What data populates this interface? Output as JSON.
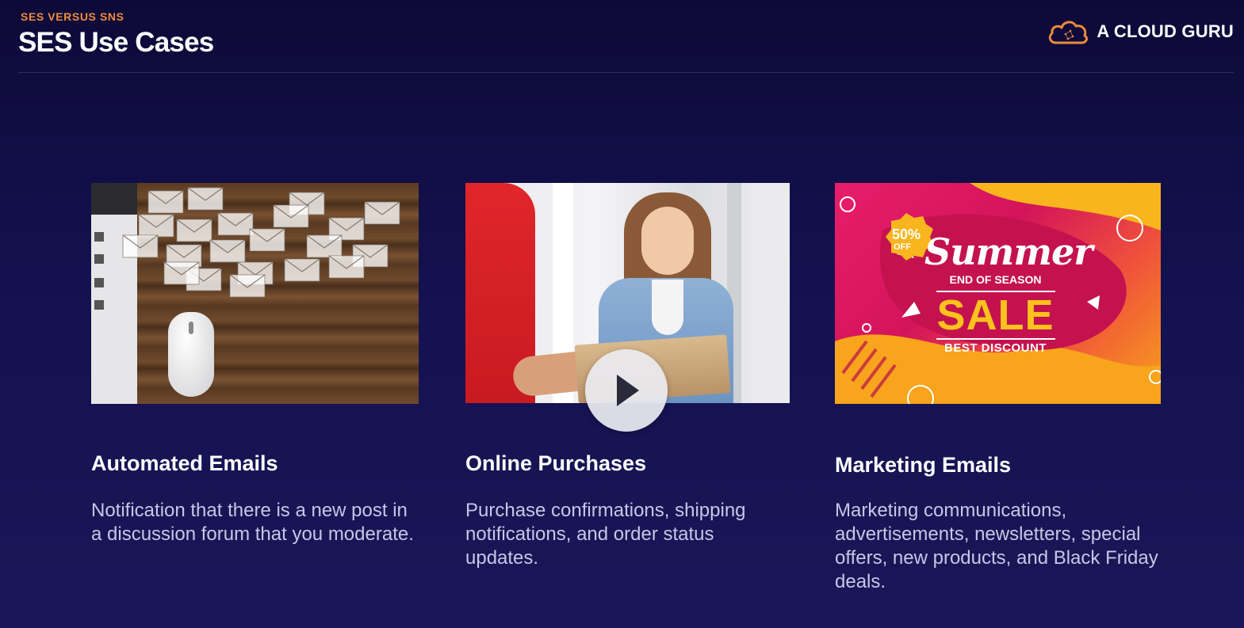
{
  "header": {
    "eyebrow": "SES VERSUS SNS",
    "title": "SES Use Cases",
    "brand": "A CLOUD GURU"
  },
  "cards": [
    {
      "title": "Automated Emails",
      "description": "Notification that there is a new post in a discussion forum that you moderate."
    },
    {
      "title": "Online Purchases",
      "description": "Purchase confirmations, shipping notifications, and order status updates."
    },
    {
      "title": "Marketing Emails",
      "description": "Marketing communications, advertisements, newsletters, special offers, new products, and Black Friday deals."
    }
  ],
  "promo_image": {
    "badge_percent": "50%",
    "badge_off": "OFF",
    "script_word": "Summer",
    "line1": "END OF SEASON",
    "line2": "SALE",
    "line3": "BEST DISCOUNT"
  },
  "colors": {
    "accent": "#f08a3c",
    "background": "#141150",
    "body_text": "#c8c6e6"
  },
  "icons": [
    "cloud-logo-icon",
    "envelope-icon",
    "play-icon"
  ]
}
